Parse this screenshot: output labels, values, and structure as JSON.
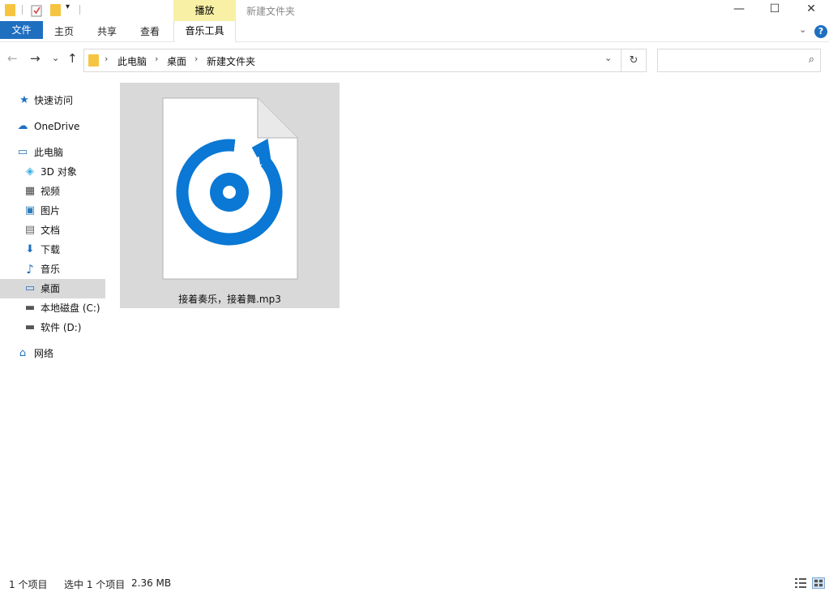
{
  "window": {
    "title": "新建文件夹",
    "context_tab_label": "播放",
    "minimize": "—",
    "maximize": "☐",
    "close": "✕"
  },
  "ribbon": {
    "file_tab": "文件",
    "tabs": [
      "主页",
      "共享",
      "查看"
    ],
    "context_tab": "音乐工具",
    "collapse_glyph": "⌄",
    "help_glyph": "?"
  },
  "nav": {
    "back": "←",
    "forward": "→",
    "recent": "⌄",
    "up": "↑",
    "breadcrumb": [
      "此电脑",
      "桌面",
      "新建文件夹"
    ],
    "crumb_sep": "›",
    "dropdown": "⌄",
    "refresh": "↻",
    "search_placeholder": "",
    "search_glyph": "⌕"
  },
  "sidebar": {
    "items": [
      {
        "label": "快速访问",
        "icon": "star-icon",
        "glyph": "★",
        "color": "#1f6fc1"
      },
      {
        "label": "OneDrive",
        "icon": "cloud-icon",
        "glyph": "☁",
        "color": "#1f6fc1"
      },
      {
        "label": "此电脑",
        "icon": "computer-icon",
        "glyph": "▭",
        "color": "#1f6fc1"
      },
      {
        "label": "3D 对象",
        "icon": "cube-icon",
        "glyph": "◈",
        "color": "#3ab0e0"
      },
      {
        "label": "视频",
        "icon": "film-icon",
        "glyph": "▦",
        "color": "#444444"
      },
      {
        "label": "图片",
        "icon": "picture-icon",
        "glyph": "▣",
        "color": "#2e7db8"
      },
      {
        "label": "文档",
        "icon": "document-icon",
        "glyph": "▤",
        "color": "#666666"
      },
      {
        "label": "下载",
        "icon": "download-icon",
        "glyph": "⬇",
        "color": "#1f6fc1"
      },
      {
        "label": "音乐",
        "icon": "music-note-icon",
        "glyph": "♪",
        "color": "#1f6fc1"
      },
      {
        "label": "桌面",
        "icon": "desktop-icon",
        "glyph": "▭",
        "color": "#1f6fc1"
      },
      {
        "label": "本地磁盘 (C:)",
        "icon": "drive-c-icon",
        "glyph": "▬",
        "color": "#555555"
      },
      {
        "label": "软件 (D:)",
        "icon": "drive-d-icon",
        "glyph": "▬",
        "color": "#555555"
      },
      {
        "label": "网络",
        "icon": "network-icon",
        "glyph": "⌂",
        "color": "#1f6fc1"
      }
    ]
  },
  "content": {
    "file_name": "接着奏乐，接着舞.mp3",
    "file_icon": "groove-music-file-icon",
    "accent": "#0a78d4"
  },
  "status": {
    "item_count": "1 个项目",
    "selected": "选中 1 个项目",
    "size": "2.36 MB"
  }
}
